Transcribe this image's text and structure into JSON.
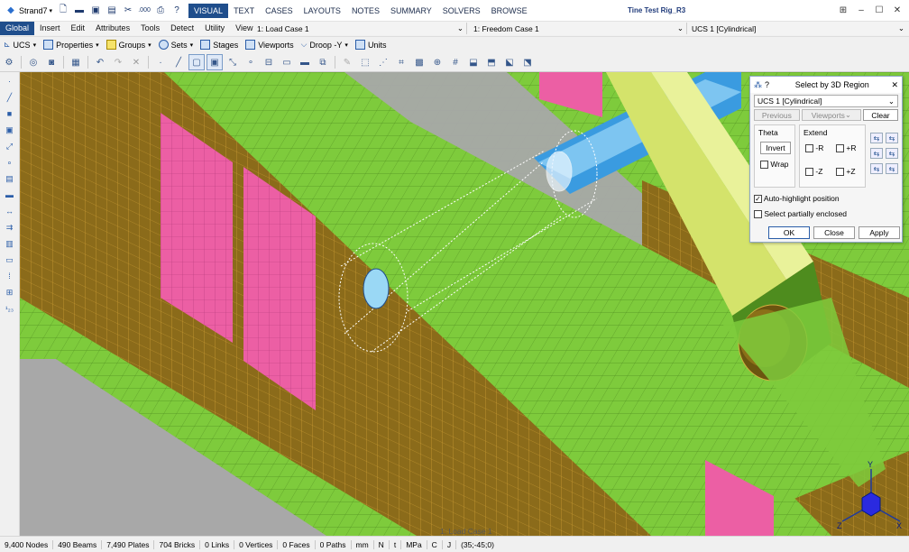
{
  "title_bar": {
    "app_menu": "Strand7",
    "tabs": [
      "VISUAL",
      "TEXT",
      "CASES",
      "LAYOUTS",
      "NOTES",
      "SUMMARY",
      "SOLVERS",
      "BROWSE"
    ],
    "active_tab": "VISUAL",
    "document_title": "Tine Test Rig_R3"
  },
  "menu_bar": {
    "items": [
      "Global",
      "Insert",
      "Edit",
      "Attributes",
      "Tools",
      "Detect",
      "Utility",
      "View"
    ],
    "selected": "Global",
    "load_case": "1: Load Case 1",
    "freedom_case": "1: Freedom Case 1",
    "coordinate_system": "UCS 1 [Cylindrical]"
  },
  "toolbar": {
    "ucs": "UCS",
    "properties": "Properties",
    "groups": "Groups",
    "sets": "Sets",
    "stages": "Stages",
    "viewports": "Viewports",
    "droop": "Droop -Y",
    "units": "Units"
  },
  "dialog": {
    "title": "Select by 3D Region",
    "help": "?",
    "coordinate_system": "UCS 1 [Cylindrical]",
    "previous": "Previous",
    "viewports": "Viewports",
    "clear": "Clear",
    "theta_label": "Theta",
    "invert": "Invert",
    "wrap": "Wrap",
    "extend_label": "Extend",
    "minus_r": "-R",
    "plus_r": "+R",
    "minus_z": "-Z",
    "plus_z": "+Z",
    "auto_highlight": "Auto-highlight position",
    "auto_highlight_checked": true,
    "select_partial": "Select partially enclosed",
    "select_partial_checked": false,
    "ok": "OK",
    "close": "Close",
    "apply": "Apply"
  },
  "viewport": {
    "load_case_note": "1: Load Case 1",
    "axis_labels": {
      "y": "Y",
      "x": "X",
      "z": "Z"
    }
  },
  "status_bar": {
    "nodes": "9,400 Nodes",
    "beams": "490 Beams",
    "plates": "7,490 Plates",
    "bricks": "704 Bricks",
    "links": "0 Links",
    "vertices": "0 Vertices",
    "faces": "0 Faces",
    "paths": "0 Paths",
    "unit_length": "mm",
    "unit_force": "N",
    "unit_mass": "t",
    "unit_stress": "MPa",
    "unit_temp": "C",
    "unit_energy": "J",
    "cursor": "(35;-45;0)"
  },
  "colors": {
    "accent": "#1f4e8c",
    "mesh_green": "#7ecb3c",
    "mesh_brown": "#8b6b1a",
    "mesh_pink": "#ec5fa4",
    "beam_blue": "#3a9be0",
    "tine_yellow": "#d4e36b"
  }
}
